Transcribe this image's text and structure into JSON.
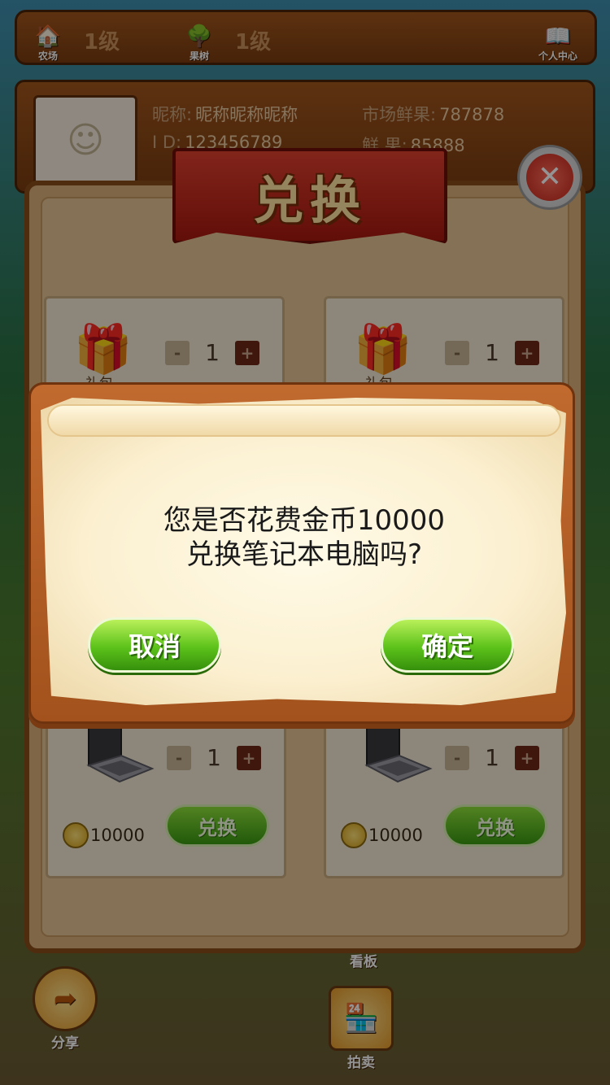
{
  "top_bar": {
    "shop_label": "农场",
    "shop_level": "1级",
    "tree_label": "果树",
    "tree_level": "1级",
    "profile_label": "个人中心"
  },
  "profile": {
    "nickname_label": "昵称:",
    "nickname_value": "昵称昵称昵称",
    "id_label": "I D:",
    "id_value": "123456789",
    "market_label": "市场鲜果:",
    "market_value": "787878",
    "fruit_label": "鲜    果:",
    "fruit_value": "85888"
  },
  "exchange_panel": {
    "title": "兑换",
    "items": [
      {
        "name": "礼包",
        "qty": "1",
        "minus": "-",
        "plus": "+"
      },
      {
        "name": "礼包",
        "qty": "1",
        "minus": "-",
        "plus": "+"
      },
      {
        "qty": "1",
        "minus": "-",
        "plus": "+",
        "price": "10000",
        "button": "兑换"
      },
      {
        "qty": "1",
        "minus": "-",
        "plus": "+",
        "price": "10000",
        "button": "兑换"
      }
    ]
  },
  "bottom": {
    "share_label": "分享",
    "middle_label": "看板",
    "auction_label": "拍卖"
  },
  "dialog": {
    "line1": "您是否花费金币10000",
    "line2": "兑换笔记本电脑吗?",
    "cancel": "取消",
    "confirm": "确定"
  },
  "colors": {
    "panel_wood": "#8a4c1a",
    "ribbon_red": "#c62a1c",
    "button_green": "#5cc21a",
    "dialog_frame": "#b85f27"
  }
}
